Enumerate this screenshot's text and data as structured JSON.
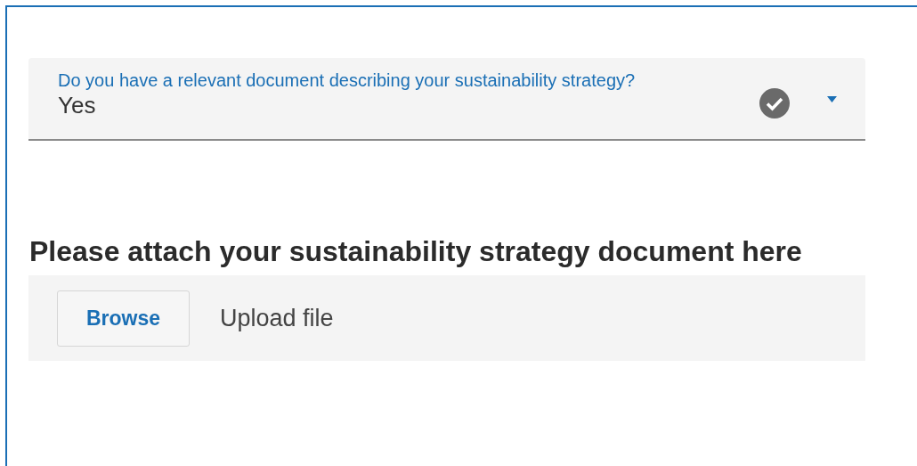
{
  "question": {
    "label": "Do you have a relevant document describing your sustainability strategy?",
    "value": "Yes",
    "valid": true
  },
  "attachment": {
    "heading": "Please attach your sustainability strategy document here",
    "button": "Browse",
    "placeholder": "Upload file"
  }
}
